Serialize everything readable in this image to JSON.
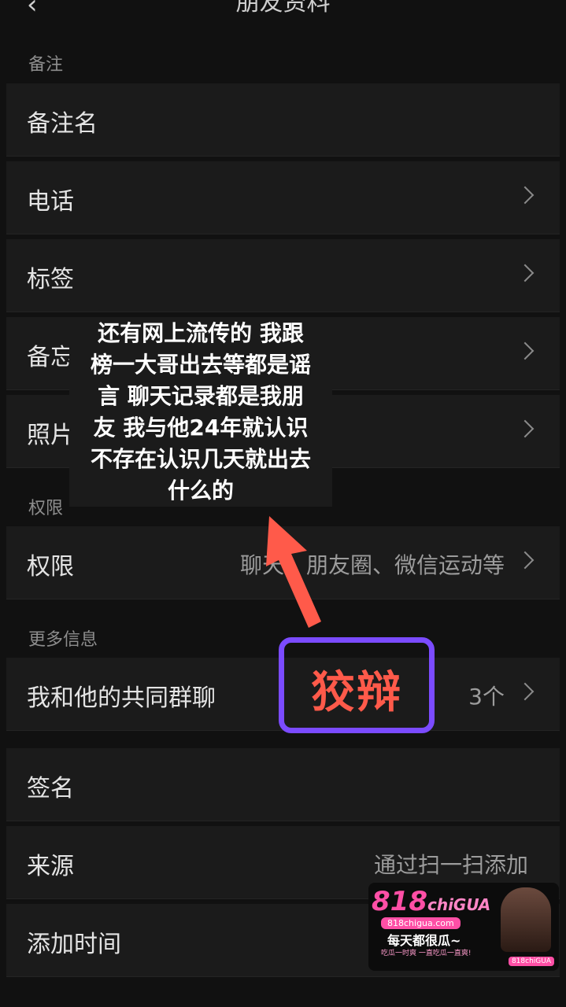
{
  "header": {
    "title": "朋友资料",
    "back_icon": "chevron-left-icon"
  },
  "sections": {
    "remark": {
      "label": "备注"
    },
    "permission": {
      "label": "权限"
    },
    "more": {
      "label": "更多信息"
    }
  },
  "rows": {
    "remark_name": {
      "label": "备注名"
    },
    "phone": {
      "label": "电话"
    },
    "tags": {
      "label": "标签"
    },
    "memo": {
      "label": "备忘"
    },
    "photos": {
      "label": "照片"
    },
    "permission": {
      "label": "权限",
      "value": "聊天、朋友圈、微信运动等"
    },
    "common_groups": {
      "label": "我和他的共同群聊",
      "value": "3个"
    },
    "signature": {
      "label": "签名"
    },
    "source": {
      "label": "来源",
      "value": "通过扫一扫添加"
    },
    "added_time": {
      "label": "添加时间"
    }
  },
  "overlay": {
    "lines": [
      "还有网上流传的 我跟",
      "榜一大哥出去等都是谣",
      "言 聊天记录都是我朋",
      "友 我与他24年就认识",
      "不存在认识几天就出去",
      "什么的"
    ],
    "arrow_color": "#ff5a4a"
  },
  "callout": {
    "text": "狡辩",
    "border_color": "#7b4bff",
    "text_color": "#ff5a4a"
  },
  "ad": {
    "logo_main": "818",
    "logo_script": "chiGUA",
    "domain": "818chigua.com",
    "slogan": "每天都很瓜~",
    "sub": "吃瓜一时爽 一直吃瓜一直爽!",
    "badge": "818chiGUA"
  }
}
